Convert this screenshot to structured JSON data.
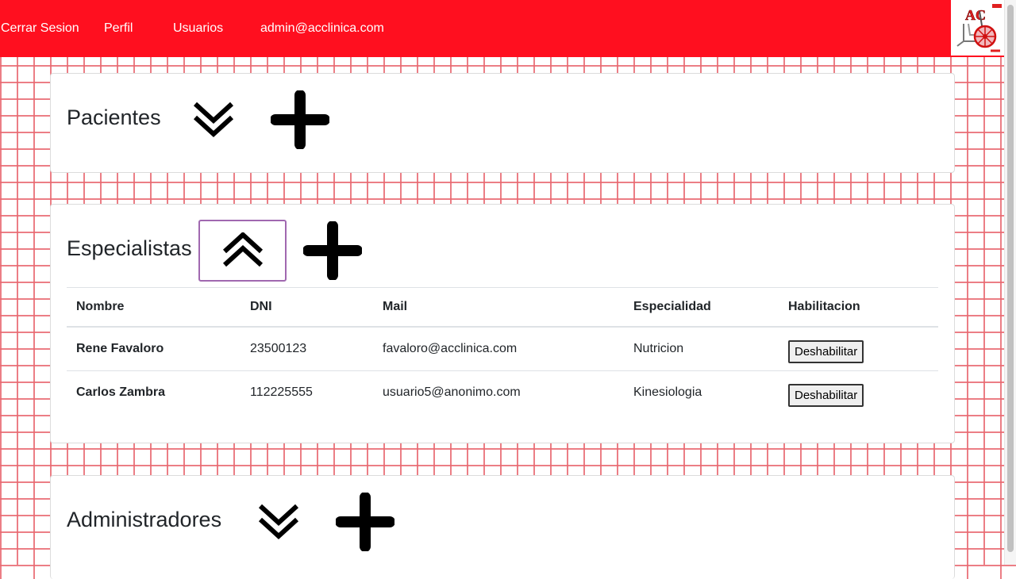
{
  "nav": {
    "logout": "Cerrar Sesion",
    "profile": "Perfil",
    "users": "Usuarios",
    "email": "admin@acclinica.com"
  },
  "logo": {
    "text": "AC",
    "icon": "wheelchair-logo-icon"
  },
  "colors": {
    "navbar": "#ff0f1f",
    "brick": "#e86870",
    "focus": "#a068b0"
  },
  "sections": {
    "pacientes": {
      "title": "Pacientes",
      "toggle_icon": "chevron-double-down-icon",
      "add_icon": "plus-icon"
    },
    "especialistas": {
      "title": "Especialistas",
      "toggle_icon": "chevron-double-up-icon",
      "add_icon": "plus-icon",
      "table": {
        "headers": [
          "Nombre",
          "DNI",
          "Mail",
          "Especialidad",
          "Habilitacion"
        ],
        "rows": [
          {
            "name": "Rene Favaloro",
            "dni": "23500123",
            "mail": "favaloro@acclinica.com",
            "specialty": "Nutricion",
            "action": "Deshabilitar"
          },
          {
            "name": "Carlos Zambra",
            "dni": "112225555",
            "mail": "usuario5@anonimo.com",
            "specialty": "Kinesiologia",
            "action": "Deshabilitar"
          }
        ]
      }
    },
    "administradores": {
      "title": "Administradores",
      "toggle_icon": "chevron-double-down-icon",
      "add_icon": "plus-icon"
    }
  }
}
